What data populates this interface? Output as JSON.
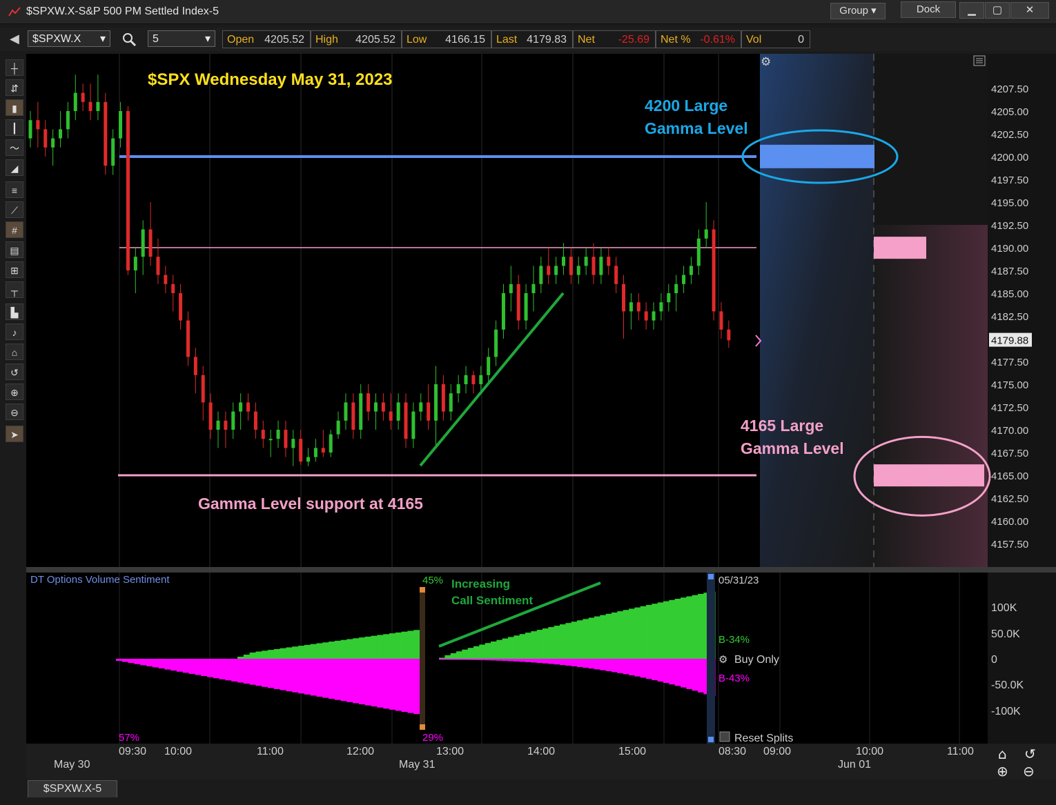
{
  "window": {
    "title": "$SPXW.X-S&P 500 PM Settled Index-5",
    "group_label": "Group",
    "dock_label": "Dock",
    "min_icon": "minimize-icon",
    "max_icon": "maximize-icon",
    "close_icon": "close-icon"
  },
  "toolbar": {
    "symbol": "$SPXW.X",
    "interval": "5",
    "quote": [
      {
        "label": "Open",
        "value": "4205.52",
        "color": "#cfcfcf"
      },
      {
        "label": "High",
        "value": "4205.52",
        "color": "#cfcfcf"
      },
      {
        "label": "Low",
        "value": "4166.15",
        "color": "#cfcfcf"
      },
      {
        "label": "Last",
        "value": "4179.83",
        "color": "#cfcfcf"
      },
      {
        "label": "Net",
        "value": "-25.69",
        "color": "#e02020"
      },
      {
        "label": "Net %",
        "value": "-0.61%",
        "color": "#e02020"
      },
      {
        "label": "Vol",
        "value": "0",
        "color": "#cfcfcf"
      }
    ]
  },
  "annotations": {
    "title": "$SPX Wednesday May 31, 2023",
    "gamma_4200_line1": "4200 Large",
    "gamma_4200_line2": "Gamma Level",
    "gamma_4165_line1": "4165  Large",
    "gamma_4165_line2": "Gamma Level",
    "support": "Gamma Level support at 4165",
    "increasing1": "Increasing",
    "increasing2": "Call Sentiment"
  },
  "price_axis": {
    "ticks": [
      "4207.50",
      "4205.00",
      "4202.50",
      "4200.00",
      "4197.50",
      "4195.00",
      "4192.50",
      "4190.00",
      "4187.50",
      "4185.00",
      "4182.50",
      "4179.88",
      "4177.50",
      "4175.00",
      "4172.50",
      "4170.00",
      "4167.50",
      "4165.00",
      "4162.50",
      "4160.00",
      "4157.50"
    ],
    "last": "4179.88"
  },
  "sentiment": {
    "title": "DT Options Volume Sentiment",
    "pct_left_top": "45%",
    "pct_left_bottom": "29%",
    "pct_start": "57%",
    "date": "05/31/23",
    "buy_pct": "B-34%",
    "sell_pct": "B-43%",
    "buy_only": "Buy Only",
    "reset": "Reset Splits",
    "axis": [
      "100K",
      "50.0K",
      "0",
      "-50.0K",
      "-100K"
    ]
  },
  "time_axis": {
    "times": [
      "09:30",
      "10:00",
      "11:00",
      "12:00",
      "13:00",
      "14:00",
      "15:00",
      "08:30",
      "09:00",
      "10:00",
      "11:00"
    ],
    "dates": [
      "May 30",
      "May 31",
      "Jun 01"
    ]
  },
  "bottom_tab": "$SPXW.X-5",
  "colors": {
    "up": "#2fc02f",
    "down": "#e02a2a",
    "blue_level": "#5b8ff0",
    "pink_level": "#f4a0c8",
    "annotation_yellow": "#ffe01a",
    "annotation_blue": "#1aa8e8",
    "green_arrow": "#1fa83c",
    "magenta": "#ff00ff"
  },
  "chart_data": {
    "type": "candlestick",
    "ylim": [
      4155,
      4210
    ],
    "levels": [
      {
        "price": 4200.0,
        "color": "#5b8ff0"
      },
      {
        "price": 4190.0,
        "color": "#f4a0c8"
      },
      {
        "price": 4165.0,
        "color": "#f4a0c8"
      }
    ],
    "candles": [
      [
        4202,
        4205,
        4201,
        4204
      ],
      [
        4204,
        4206,
        4201,
        4203
      ],
      [
        4203,
        4204,
        4200,
        4201
      ],
      [
        4201,
        4203,
        4199,
        4202
      ],
      [
        4202,
        4205,
        4201,
        4203
      ],
      [
        4203,
        4206,
        4202,
        4205
      ],
      [
        4205,
        4209,
        4204,
        4207
      ],
      [
        4207,
        4208,
        4205,
        4206
      ],
      [
        4206,
        4208,
        4204,
        4205
      ],
      [
        4205,
        4209,
        4204,
        4206
      ],
      [
        4206,
        4207,
        4198,
        4199
      ],
      [
        4199,
        4203,
        4198,
        4202
      ],
      [
        4202,
        4206,
        4201,
        4205
      ],
      [
        4205,
        4205.52,
        4187,
        4187.5
      ],
      [
        4187.5,
        4190,
        4185,
        4189
      ],
      [
        4189,
        4193,
        4187,
        4192
      ],
      [
        4192,
        4195,
        4188,
        4189
      ],
      [
        4189,
        4191,
        4186,
        4187
      ],
      [
        4187,
        4188,
        4185,
        4186
      ],
      [
        4186,
        4187,
        4183,
        4185
      ],
      [
        4185,
        4186,
        4181,
        4182
      ],
      [
        4182,
        4183,
        4177,
        4178
      ],
      [
        4178,
        4179,
        4174,
        4176
      ],
      [
        4176,
        4177,
        4171,
        4173
      ],
      [
        4173,
        4174,
        4169,
        4170
      ],
      [
        4170,
        4172,
        4168,
        4171
      ],
      [
        4171,
        4172,
        4168,
        4170
      ],
      [
        4170,
        4173,
        4169,
        4172
      ],
      [
        4172,
        4174,
        4170,
        4173
      ],
      [
        4173,
        4174,
        4171,
        4172
      ],
      [
        4172,
        4173,
        4169,
        4170
      ],
      [
        4170,
        4171,
        4168,
        4169
      ],
      [
        4169,
        4170,
        4167,
        4169
      ],
      [
        4169,
        4171,
        4168,
        4170
      ],
      [
        4170,
        4171,
        4167,
        4168
      ],
      [
        4168,
        4170,
        4166,
        4169
      ],
      [
        4169,
        4170,
        4166.15,
        4166.5
      ],
      [
        4166.5,
        4168,
        4166,
        4167
      ],
      [
        4167,
        4169,
        4166.5,
        4168
      ],
      [
        4168,
        4170,
        4167,
        4167.5
      ],
      [
        4167.5,
        4170,
        4167,
        4169.5
      ],
      [
        4169.5,
        4172,
        4169,
        4171
      ],
      [
        4171,
        4174,
        4170,
        4173
      ],
      [
        4173,
        4174,
        4169,
        4170
      ],
      [
        4170,
        4175,
        4169,
        4174
      ],
      [
        4174,
        4175,
        4171,
        4172
      ],
      [
        4172,
        4174,
        4170,
        4173
      ],
      [
        4173,
        4174,
        4171,
        4172
      ],
      [
        4172,
        4174,
        4170,
        4171
      ],
      [
        4171,
        4174,
        4170,
        4173
      ],
      [
        4173,
        4174,
        4168,
        4169
      ],
      [
        4169,
        4173,
        4168,
        4172
      ],
      [
        4172,
        4174,
        4171,
        4173
      ],
      [
        4173,
        4175,
        4170,
        4171
      ],
      [
        4171,
        4177,
        4168,
        4175
      ],
      [
        4175,
        4176,
        4171,
        4172
      ],
      [
        4172,
        4175,
        4171,
        4174
      ],
      [
        4174,
        4176,
        4173,
        4175
      ],
      [
        4175,
        4177,
        4174,
        4176
      ],
      [
        4176,
        4176.5,
        4174,
        4175
      ],
      [
        4175,
        4177,
        4174,
        4176
      ],
      [
        4176,
        4179,
        4175,
        4178
      ],
      [
        4178,
        4182,
        4177,
        4181
      ],
      [
        4181,
        4186,
        4180,
        4185
      ],
      [
        4185,
        4188,
        4183,
        4186
      ],
      [
        4186,
        4187,
        4181,
        4182
      ],
      [
        4182,
        4186,
        4181,
        4185
      ],
      [
        4185,
        4188,
        4183,
        4186
      ],
      [
        4186,
        4189,
        4185,
        4188
      ],
      [
        4188,
        4190,
        4186,
        4187
      ],
      [
        4187,
        4189,
        4186,
        4188
      ],
      [
        4188,
        4190.5,
        4187,
        4189
      ],
      [
        4189,
        4190,
        4186,
        4187
      ],
      [
        4187,
        4189,
        4186,
        4188
      ],
      [
        4188,
        4190,
        4187,
        4189
      ],
      [
        4189,
        4190.5,
        4186,
        4187
      ],
      [
        4187,
        4190,
        4186,
        4189
      ],
      [
        4189,
        4190,
        4187,
        4188
      ],
      [
        4188,
        4189,
        4185,
        4186
      ],
      [
        4186,
        4187,
        4180,
        4183
      ],
      [
        4183,
        4185,
        4181,
        4184
      ],
      [
        4184,
        4185,
        4182,
        4183
      ],
      [
        4183,
        4184,
        4181,
        4182
      ],
      [
        4182,
        4184,
        4181,
        4183
      ],
      [
        4183,
        4185,
        4182,
        4184
      ],
      [
        4184,
        4186,
        4183,
        4185
      ],
      [
        4185,
        4187,
        4183,
        4186
      ],
      [
        4186,
        4188,
        4185,
        4187
      ],
      [
        4187,
        4189,
        4186,
        4188
      ],
      [
        4188,
        4192,
        4187,
        4191
      ],
      [
        4191,
        4195,
        4190,
        4192
      ],
      [
        4192,
        4193,
        4182,
        4183
      ],
      [
        4183,
        4184,
        4180,
        4181
      ],
      [
        4181,
        4182,
        4179,
        4179.83
      ]
    ]
  }
}
